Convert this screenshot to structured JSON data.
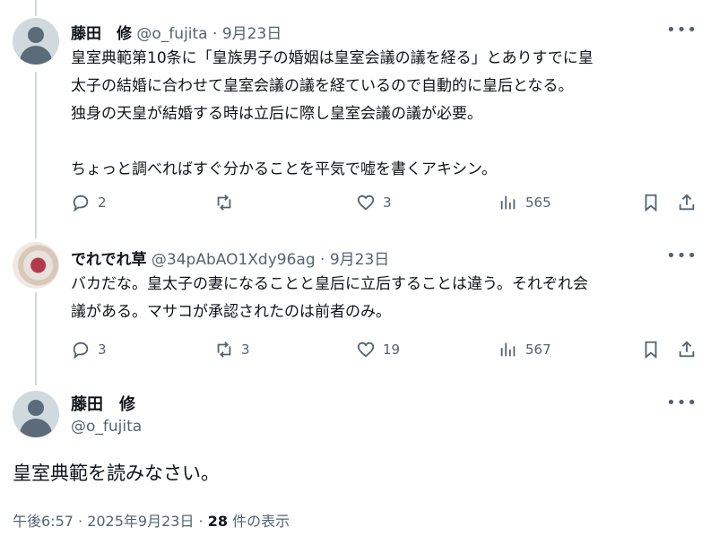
{
  "tweets": [
    {
      "name": "藤田　修",
      "handle": "@o_fujita",
      "sep": "·",
      "date": "9月23日",
      "more": "•••",
      "lines": [
        "皇室典範第10条に「皇族男子の婚姻は皇室会議の議を経る」とありすでに皇",
        "太子の結婚に合わせて皇室会議の議を経ているので自動的に皇后となる。",
        "独身の天皇が結婚する時は立后に際し皇室会議の議が必要。",
        "",
        "ちょっと調べればすぐ分かることを平気で嘘を書くアキシン。"
      ],
      "replies": "2",
      "retweets": "",
      "likes": "3",
      "views": "565"
    },
    {
      "name": "でれでれ草",
      "handle": "@34pAbAO1Xdy96ag",
      "sep": "·",
      "date": "9月23日",
      "more": "•••",
      "lines": [
        "バカだな。皇太子の妻になることと皇后に立后することは違う。それぞれ会",
        "議がある。マサコが承認されたのは前者のみ。"
      ],
      "replies": "3",
      "retweets": "3",
      "likes": "19",
      "views": "567"
    }
  ],
  "focus": {
    "name": "藤田　修",
    "handle": "@o_fujita",
    "more": "•••",
    "text": "皇室典範を読みなさい。",
    "time": "午後6:57 · 2025年9月23日 · ",
    "views_count": "28",
    "views_label": " 件の表示"
  }
}
